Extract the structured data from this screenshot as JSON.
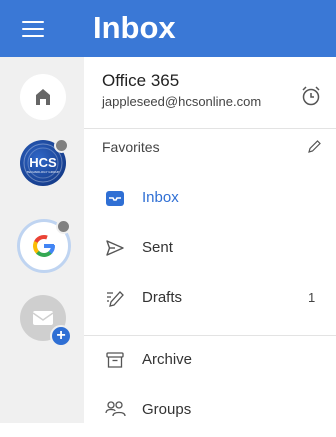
{
  "header": {
    "title": "Inbox"
  },
  "rail": {
    "accounts": [
      {
        "name": "home-account",
        "icon": "home-icon"
      },
      {
        "name": "hcs-account",
        "logo_text": "HCS",
        "logo_subtext": "TECHNOLOGY GROUP",
        "status": "gray-dot"
      },
      {
        "name": "google-account",
        "logo_text": "G",
        "status": "gray-dot"
      },
      {
        "name": "add-mail-account",
        "icon": "mail-icon",
        "badge_icon": "plus-icon"
      }
    ]
  },
  "account": {
    "name": "Office 365",
    "email": "jappleseed@hcsonline.com"
  },
  "favorites": {
    "title": "Favorites"
  },
  "nav": {
    "inbox": {
      "label": "Inbox",
      "icon": "inbox-icon"
    },
    "sent": {
      "label": "Sent",
      "icon": "sent-icon"
    },
    "drafts": {
      "label": "Drafts",
      "icon": "drafts-icon",
      "count": "1"
    },
    "archive": {
      "label": "Archive",
      "icon": "archive-icon"
    },
    "groups": {
      "label": "Groups",
      "icon": "groups-icon"
    }
  },
  "colors": {
    "accent": "#3a78d6",
    "rail_bg": "#f0f0f0",
    "active_text": "#2f6fd4"
  }
}
